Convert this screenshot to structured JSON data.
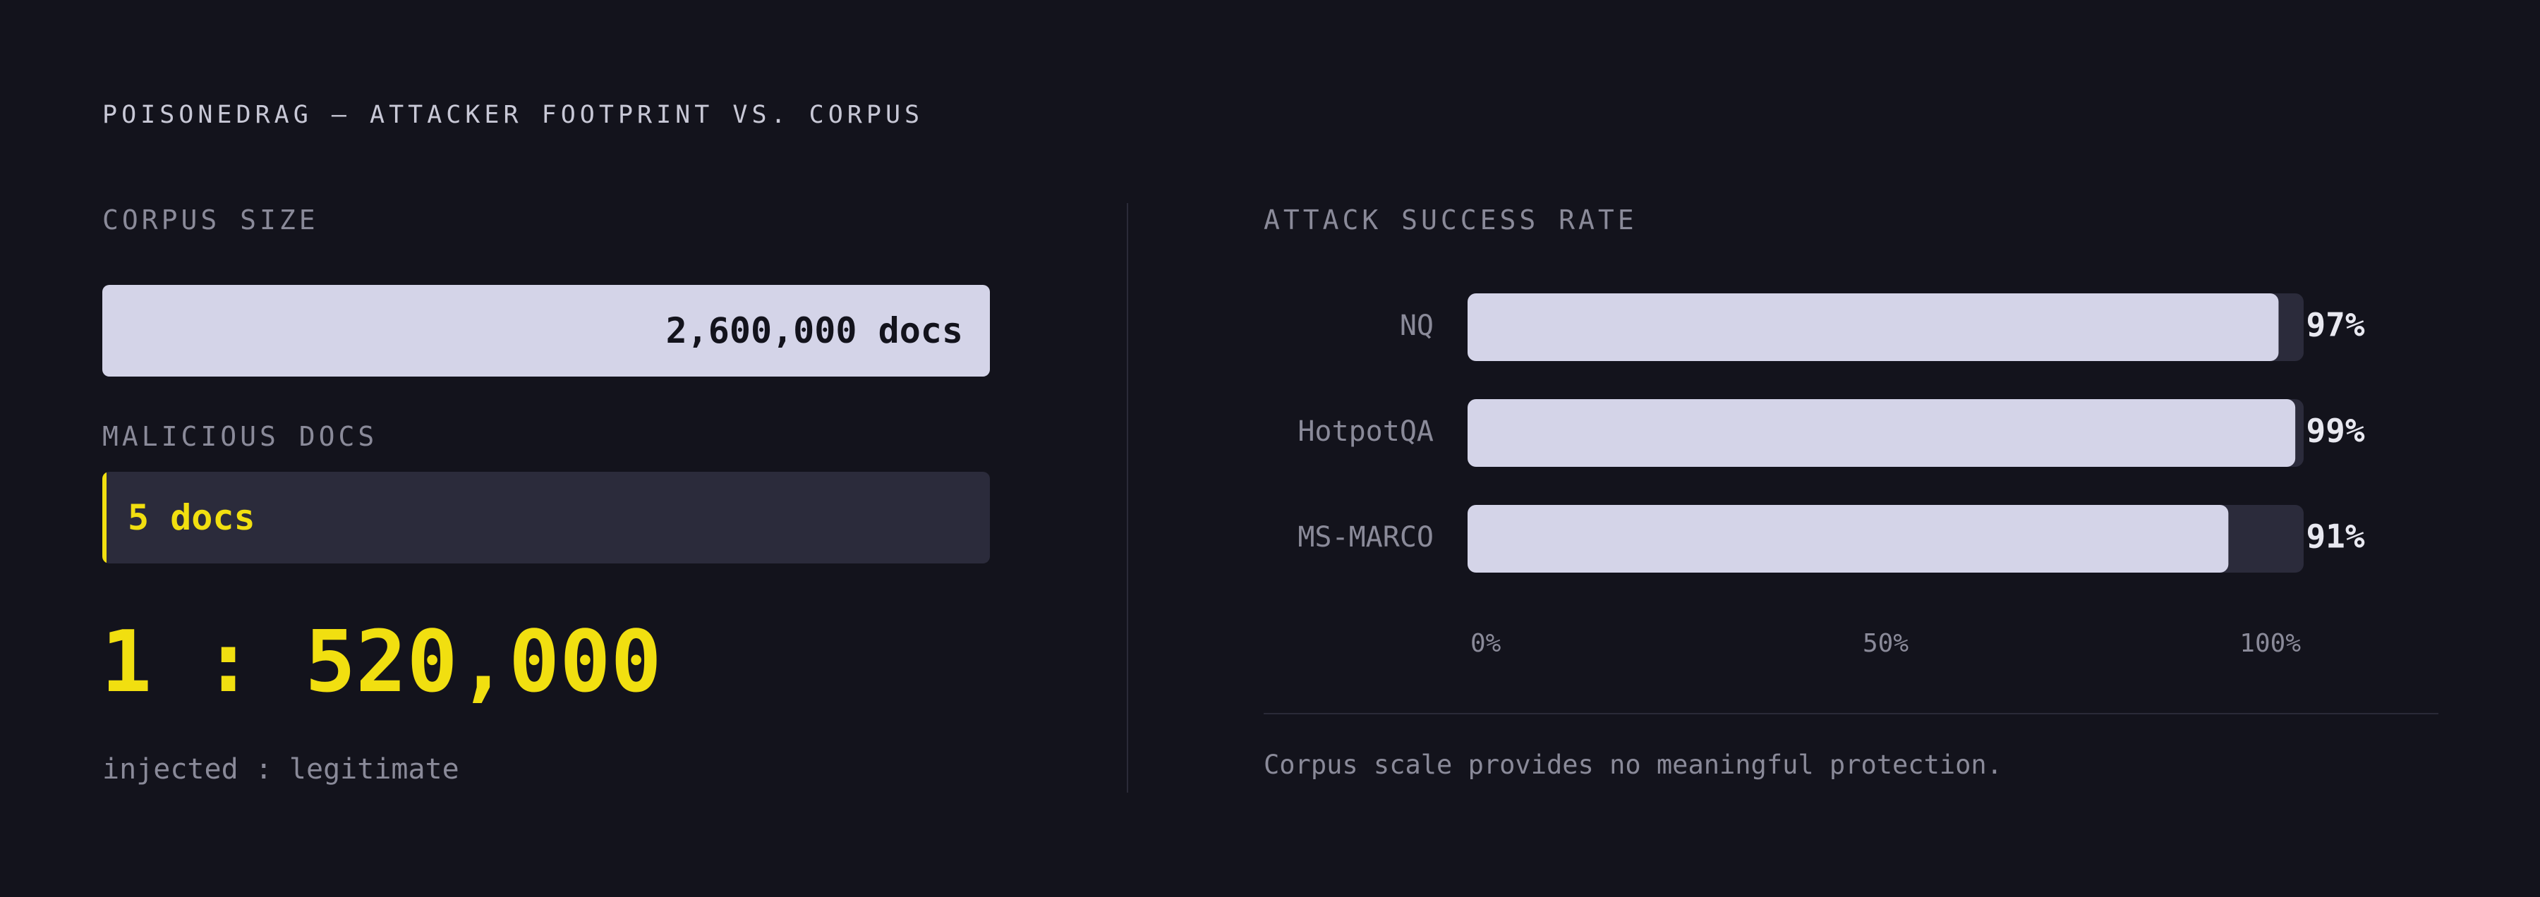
{
  "title": "POISONEDRAG — ATTACKER FOOTPRINT VS. CORPUS",
  "left_panel": {
    "corpus_label": "CORPUS SIZE",
    "corpus_value": "2,600,000 docs",
    "malicious_label": "MALICIOUS DOCS",
    "malicious_value": "5 docs",
    "ratio": "1 : 520,000",
    "ratio_caption": "injected : legitimate"
  },
  "right_panel": {
    "heading": "ATTACK SUCCESS RATE",
    "footnote": "Corpus scale provides no meaningful protection."
  },
  "colors": {
    "background": "#13131c",
    "bar_fill": "#d4d4e8",
    "bar_track": "#2b2b3b",
    "accent": "#f1df10",
    "label": "#8a8a99",
    "value_text": "#e8e8f0"
  },
  "chart_data": {
    "type": "bar",
    "orientation": "horizontal",
    "title": "ATTACK SUCCESS RATE",
    "categories": [
      "NQ",
      "HotpotQA",
      "MS-MARCO"
    ],
    "values": [
      97,
      99,
      91
    ],
    "value_labels": [
      "97%",
      "99%",
      "91%"
    ],
    "unit": "%",
    "xlim": [
      0,
      100
    ],
    "xticks": [
      0,
      50,
      100
    ],
    "xtick_labels": [
      "0%",
      "50%",
      "100%"
    ],
    "grid": false,
    "legend": "none"
  }
}
